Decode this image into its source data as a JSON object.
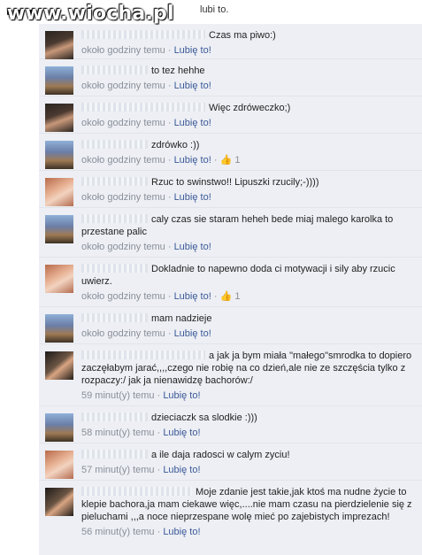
{
  "watermark": "www.wiocha.pl",
  "top_partial": "lubi to.",
  "like_label": "Lubię to!",
  "comments": [
    {
      "text": "Czas ma piwo:)",
      "time": "około godziny temu",
      "likes": ""
    },
    {
      "text": "to tez hehhe",
      "time": "około godziny temu",
      "likes": ""
    },
    {
      "text": "Więc zdróweczko;)",
      "time": "około godziny temu",
      "likes": ""
    },
    {
      "text": "zdrówko :))",
      "time": "około godziny temu",
      "likes": "1"
    },
    {
      "text": "Rzuc to swinstwo!! Lipuszki rzucily;-))))",
      "time": "około godziny temu",
      "likes": ""
    },
    {
      "text": "caly czas sie staram heheh bede miaj malego karolka to przestane palic",
      "time": "około godziny temu",
      "likes": ""
    },
    {
      "text": "Dokladnie to napewno doda ci motywacji i sily aby rzucic uwierz.",
      "time": "około godziny temu",
      "likes": "1"
    },
    {
      "text": "mam nadzieje",
      "time": "około godziny temu",
      "likes": ""
    },
    {
      "text": "a jak ja bym miała \"małego\"smrodka to dopiero zaczęłabym jarać,,,,czego nie robię na co dzień,ale nie ze szczęścia tylko z rozpaczy:/ jak ja nienawidzę bachorów:/",
      "time": "59 minut(y) temu",
      "likes": ""
    },
    {
      "text": "dzieciaczk sa slodkie :)))",
      "time": "58 minut(y) temu",
      "likes": ""
    },
    {
      "text": "a ile daja radosci w calym zyciu!",
      "time": "57 minut(y) temu",
      "likes": ""
    },
    {
      "text": "Moje zdanie jest takie,jak ktoś ma nudne życie to klepie bachora,ja mam ciekawe więc,....nie mam czasu na pierdzielenie się z pieluchami ,,,a noce nieprzespane wolę mieć po zajebistych imprezach!",
      "time": "56 minut(y) temu",
      "likes": ""
    }
  ]
}
